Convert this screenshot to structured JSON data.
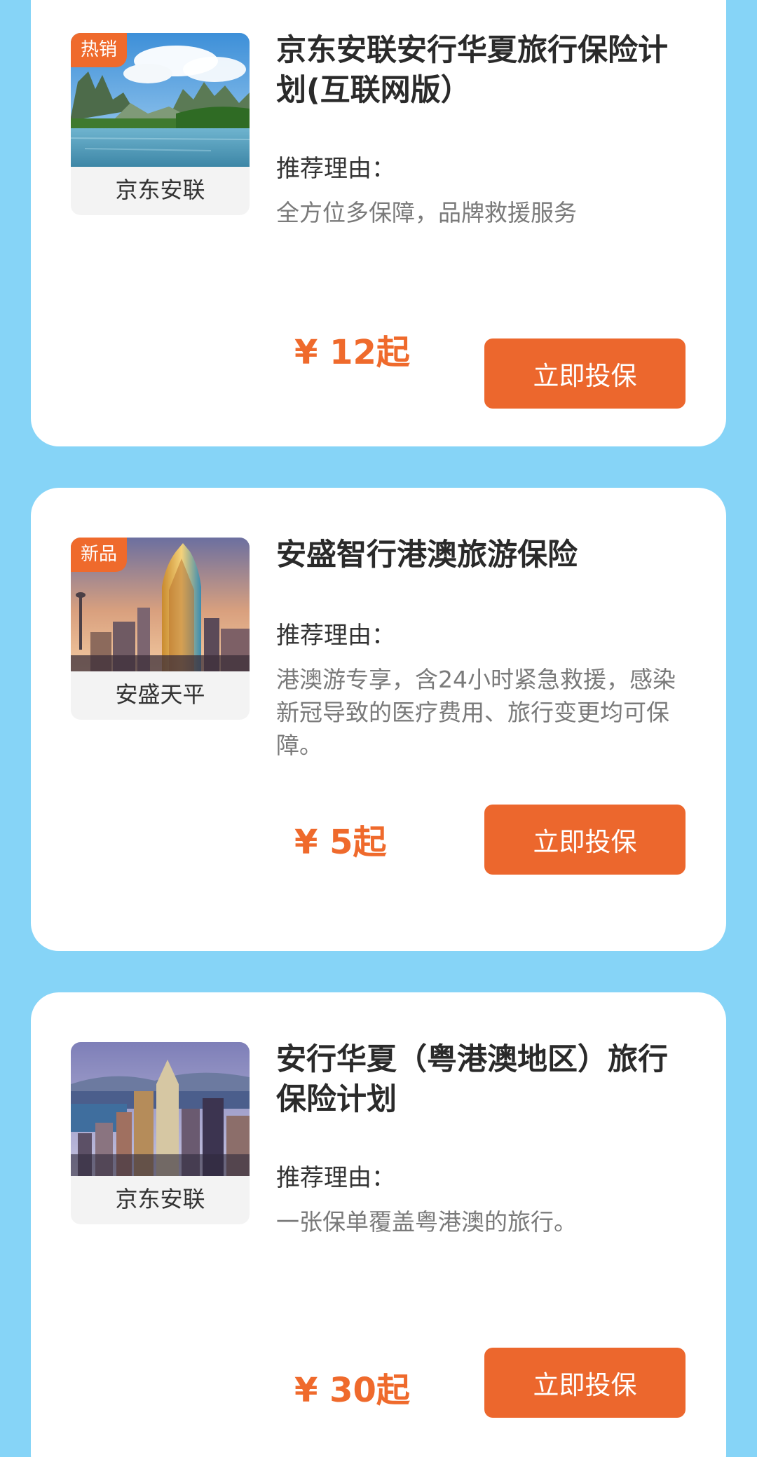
{
  "products": [
    {
      "badge": "热销",
      "image_icon": "guilin-landscape-photo",
      "provider": "京东安联",
      "title": "京东安联安行华夏旅行保险计划(互联网版）",
      "reason_label": "推荐理由：",
      "reason_text": "全方位多保障，品牌救援服务",
      "price": "¥ 12起",
      "button_label": "立即投保"
    },
    {
      "badge": "新品",
      "image_icon": "macau-skyline-photo",
      "provider": "安盛天平",
      "title": "安盛智行港澳旅游保险",
      "reason_label": "推荐理由：",
      "reason_text": "港澳游专享，含24小时紧急救援，感染新冠导致的医疗费用、旅行变更均可保障。",
      "price": "¥ 5起",
      "button_label": "立即投保"
    },
    {
      "badge": "",
      "image_icon": "hongkong-skyline-photo",
      "provider": "京东安联",
      "title": "安行华夏（粤港澳地区）旅行保险计划",
      "reason_label": "推荐理由：",
      "reason_text": "一张保单覆盖粤港澳的旅行。",
      "price": "¥ 30起",
      "button_label": "立即投保"
    }
  ],
  "colors": {
    "background": "#86d4f7",
    "accent": "#ec672d",
    "price": "#ef6a2c"
  }
}
